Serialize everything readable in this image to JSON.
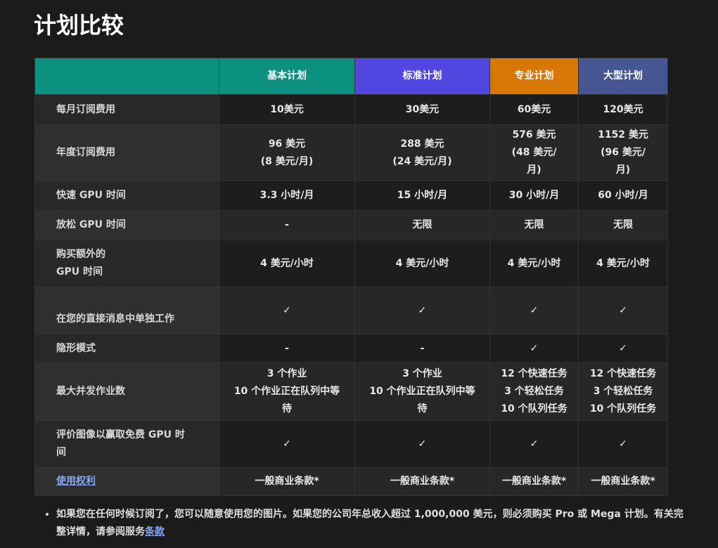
{
  "page_title": "计划比较",
  "colors": {
    "header_blank": "#0c9080",
    "basic": "#0c9080",
    "standard": "#5246e1",
    "pro": "#d67706",
    "mega": "#455692",
    "link": "#8aa7f0"
  },
  "plans": [
    {
      "name": "基本计划"
    },
    {
      "name": "标准计划"
    },
    {
      "name": "专业计划"
    },
    {
      "name": "大型计划"
    }
  ],
  "rows": [
    {
      "label": [
        "每月订阅费用"
      ],
      "values": [
        [
          "10美元"
        ],
        [
          "30美元"
        ],
        [
          "60美元"
        ],
        [
          "120美元"
        ]
      ]
    },
    {
      "label": [
        "年度订阅费用"
      ],
      "values": [
        [
          "96 美元",
          "(8 美元/月)"
        ],
        [
          "288 美元",
          "(24 美元/月)"
        ],
        [
          "576 美元",
          "(48 美元/",
          "月)"
        ],
        [
          "1152 美元",
          "(96 美元/",
          "月)"
        ]
      ]
    },
    {
      "label": [
        "快速 GPU 时间"
      ],
      "values": [
        [
          "3.3 小时/月"
        ],
        [
          "15 小时/月"
        ],
        [
          "30 小时/月"
        ],
        [
          "60 小时/月"
        ]
      ]
    },
    {
      "label": [
        "放松 GPU 时间"
      ],
      "values": [
        [
          "-"
        ],
        [
          "无限"
        ],
        [
          "无限"
        ],
        [
          "无限"
        ]
      ]
    },
    {
      "label": [
        "购买额外的",
        "GPU 时间"
      ],
      "values": [
        [
          "4 美元/小时"
        ],
        [
          "4 美元/小时"
        ],
        [
          "4 美元/小时"
        ],
        [
          "4 美元/小时"
        ]
      ]
    },
    {
      "label": [
        "在您的直接消息中单独工作"
      ],
      "values": [
        [
          "✓"
        ],
        [
          "✓"
        ],
        [
          "✓"
        ],
        [
          "✓"
        ]
      ]
    },
    {
      "label": [
        "隐形模式"
      ],
      "values": [
        [
          "-"
        ],
        [
          "-"
        ],
        [
          "✓"
        ],
        [
          "✓"
        ]
      ]
    },
    {
      "label": [
        "最大并发作业数"
      ],
      "values": [
        [
          "3 个作业",
          "10 个作业正在队列中等",
          "待"
        ],
        [
          "3 个作业",
          "10 个作业正在队列中等",
          "待"
        ],
        [
          "12 个快速任务",
          "3 个轻松任务",
          "10 个队列任务"
        ],
        [
          "12 个快速任务",
          "3 个轻松任务",
          "10 个队列任务"
        ]
      ]
    },
    {
      "label": [
        "评价图像以赢取免费 GPU 时",
        "间"
      ],
      "values": [
        [
          "✓"
        ],
        [
          "✓"
        ],
        [
          "✓"
        ],
        [
          "✓"
        ]
      ]
    },
    {
      "label": [
        "使用权利"
      ],
      "label_is_link": true,
      "values": [
        [
          "一般商业条款*"
        ],
        [
          "一般商业条款*"
        ],
        [
          "一般商业条款*"
        ],
        [
          "一般商业条款*"
        ]
      ]
    }
  ],
  "notes": {
    "text": "如果您在任何时候订阅了，您可以随意使用您的图片。如果您的公司年总收入超过 1,000,000 美元，则必须购买 Pro 或 Mega 计划。有关完整详情，请参阅服务",
    "link": "条款"
  }
}
